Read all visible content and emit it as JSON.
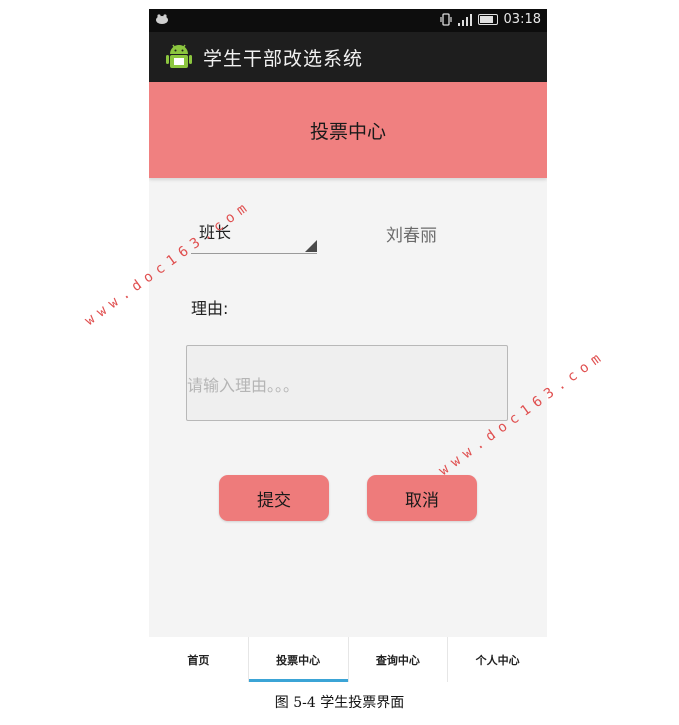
{
  "status_bar": {
    "time": "03:18",
    "icons": [
      "android-cat-icon",
      "vibrate-icon",
      "signal-icon",
      "battery-icon"
    ]
  },
  "app": {
    "title": "学生干部改选系统",
    "icon": "android-robot-icon"
  },
  "page": {
    "title": "投票中心",
    "banner_color": "#f08080"
  },
  "vote_form": {
    "position_value": "班长",
    "candidate": "刘春丽",
    "reason_label": "理由:",
    "reason_placeholder": "请输入理由。。。",
    "reason_value": "",
    "submit_label": "提交",
    "cancel_label": "取消",
    "button_color": "#ee7b7b"
  },
  "bottom_nav": {
    "active_color": "#3ba4d6",
    "tabs": [
      {
        "label": "首页",
        "active": false
      },
      {
        "label": "投票中心",
        "active": true
      },
      {
        "label": "查询中心",
        "active": false
      },
      {
        "label": "个人中心",
        "active": false
      }
    ]
  },
  "caption": "图 5-4  学生投票界面",
  "watermark": "www.doc163.com"
}
